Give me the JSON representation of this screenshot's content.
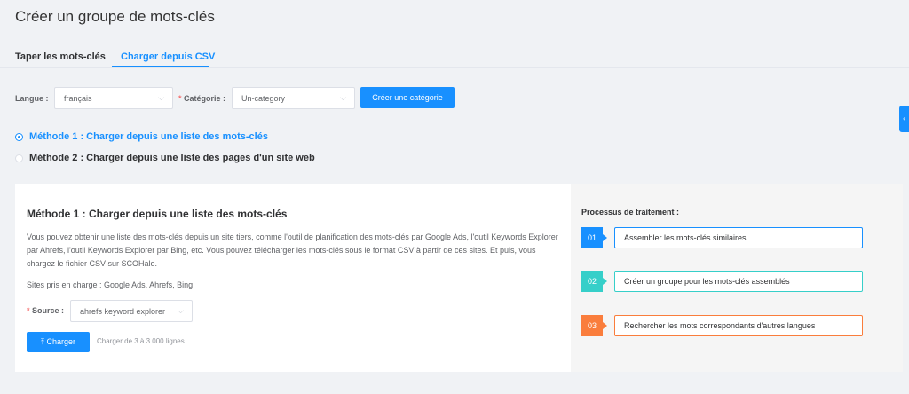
{
  "page": {
    "title": "Créer un groupe de mots-clés"
  },
  "tabs": [
    {
      "label": "Taper les mots-clés",
      "active": false
    },
    {
      "label": "Charger depuis CSV",
      "active": true
    }
  ],
  "form": {
    "language_label": "Langue :",
    "language_value": "français",
    "category_label": "Catégorie :",
    "category_value": "Un-category",
    "create_category_label": "Créer une catégorie"
  },
  "methods": [
    {
      "label": "Méthode 1 : Charger depuis une liste des mots-clés",
      "selected": true
    },
    {
      "label": "Méthode 2 : Charger depuis une liste des pages d'un site web",
      "selected": false
    }
  ],
  "panel": {
    "title": "Méthode 1 : Charger depuis une liste des mots-clés",
    "description": "Vous pouvez obtenir une liste des mots-clés depuis un site tiers, comme l'outil de planification des mots-clés par Google Ads, l'outil Keywords Explorer par Ahrefs, l'outil Keywords Explorer par Bing, etc. Vous pouvez télécharger les mots-clés sous le format CSV à partir de ces sites. Et puis, vous chargez le fichier CSV sur SCOHalo.",
    "supported_sites": "Sites pris en charge : Google Ads, Ahrefs, Bing",
    "source_label": "Source :",
    "source_value": "ahrefs keyword explorer",
    "upload_label": "Charger",
    "upload_hint": "Charger de 3 à 3 000 lignes"
  },
  "process": {
    "title": "Processus de traitement :",
    "steps": [
      {
        "num": "01",
        "label": "Assembler les mots-clés similaires",
        "color": "#1890ff"
      },
      {
        "num": "02",
        "label": "Créer un groupe pour les mots-clés assemblés",
        "color": "#36cfc9"
      },
      {
        "num": "03",
        "label": "Rechercher les mots correspondants d'autres langues",
        "color": "#fa7d3c"
      }
    ]
  },
  "colors": {
    "primary": "#1890ff",
    "teal": "#36cfc9",
    "orange": "#fa7d3c",
    "required": "#f56c6c"
  },
  "icons": {
    "chevron": "chevron-down-icon",
    "upload": "upload-icon",
    "side": "side-tab-icon"
  }
}
